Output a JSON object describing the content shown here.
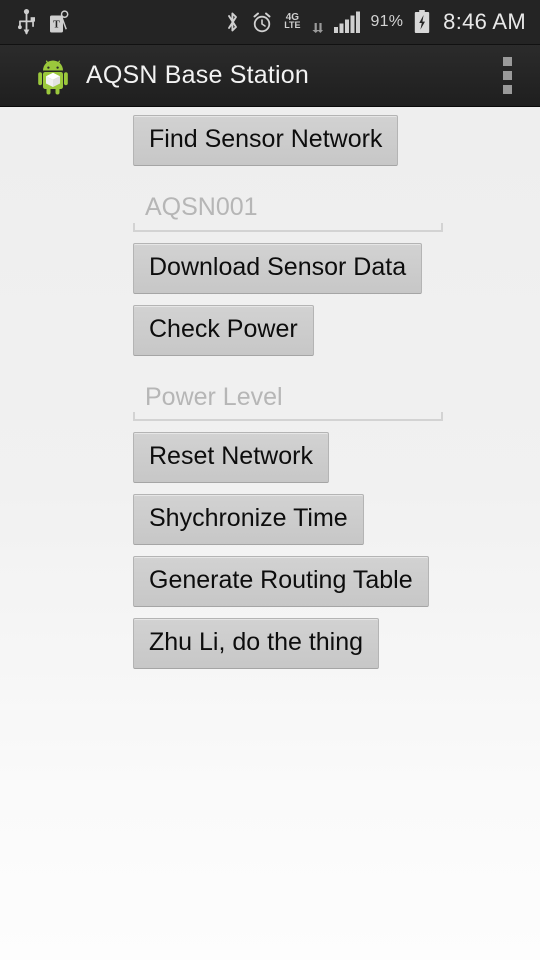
{
  "status_bar": {
    "left_icons": [
      {
        "name": "usb-icon",
        "glyph": "usb"
      },
      {
        "name": "nfc-tag-icon",
        "glyph": "tag"
      }
    ],
    "right_icons": [
      {
        "name": "bluetooth-icon",
        "glyph": "bluetooth"
      },
      {
        "name": "alarm-clock-icon",
        "glyph": "alarm"
      }
    ],
    "network_type_top": "4G",
    "network_type_bottom": "LTE",
    "battery_percent": "91%",
    "battery_state": "charging",
    "clock": "8:46 AM"
  },
  "action_bar": {
    "app_icon": "android-robot-cube-icon",
    "title": "AQSN Base Station",
    "overflow_label": "overflow-menu"
  },
  "main": {
    "controls": [
      {
        "type": "button",
        "name": "find-sensor-network-button",
        "label": "Find Sensor Network"
      },
      {
        "type": "input",
        "name": "sensor-network-id-input",
        "hint": "AQSN001",
        "value": ""
      },
      {
        "type": "button",
        "name": "download-sensor-data-button",
        "label": "Download Sensor Data"
      },
      {
        "type": "button",
        "name": "check-power-button",
        "label": "Check Power"
      },
      {
        "type": "input",
        "name": "power-level-input",
        "hint": "Power Level",
        "value": ""
      },
      {
        "type": "button",
        "name": "reset-network-button",
        "label": "Reset Network"
      },
      {
        "type": "button",
        "name": "synchronize-time-button",
        "label": "Shychronize Time"
      },
      {
        "type": "button",
        "name": "generate-routing-table-button",
        "label": "Generate Routing Table"
      },
      {
        "type": "button",
        "name": "zhu-li-do-the-thing-button",
        "label": "Zhu Li, do the thing"
      }
    ]
  },
  "colors": {
    "status_bar_bg": "#242424",
    "action_bar_bg": "#2b2b2b",
    "content_bg": "#f0f0f0",
    "button_bg": "#cccccc",
    "button_border": "#b4b4b4",
    "hint_text": "#b6b6b6",
    "title_text": "#f2f2f2",
    "android_green": "#a4c639"
  }
}
